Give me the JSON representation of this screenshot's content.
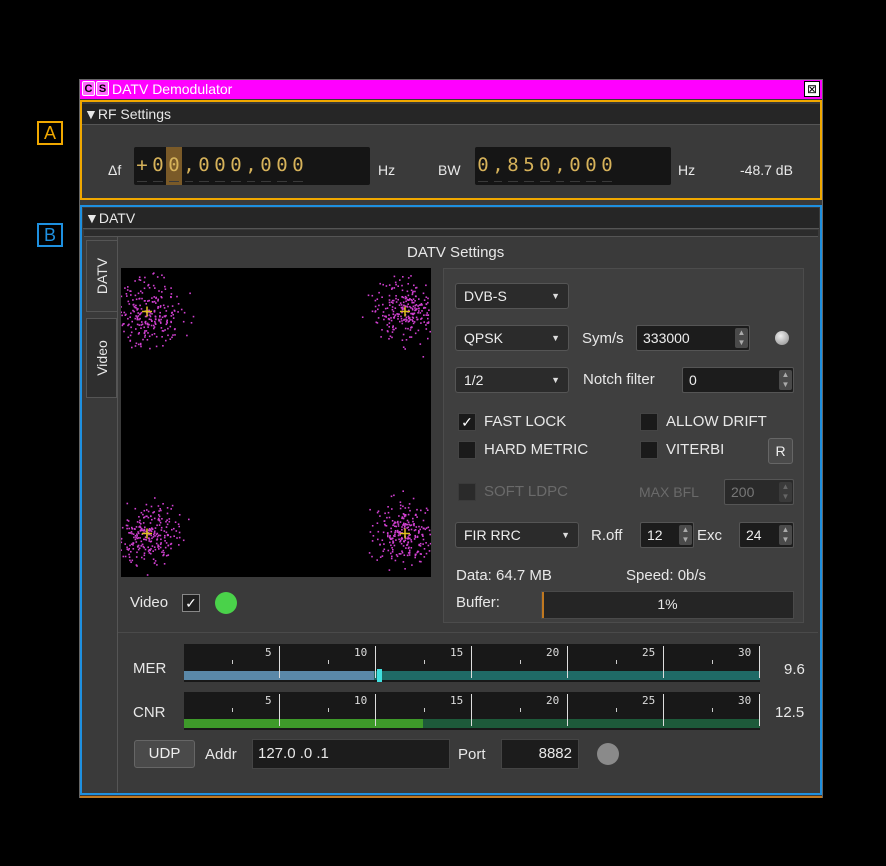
{
  "window": {
    "title": "DATV Demodulator",
    "btn_c": "C",
    "btn_s": "S",
    "close": "⊠"
  },
  "annotations": {
    "a": "A",
    "b": "B"
  },
  "rf_settings": {
    "header": "RF Settings",
    "df_label": "Δf",
    "df_digits": [
      "+",
      "0",
      "0",
      ",",
      "0",
      "0",
      "0",
      ",",
      "0",
      "0",
      "0"
    ],
    "df_unit": "Hz",
    "bw_label": "BW",
    "bw_digits": [
      "0",
      ",",
      "8",
      "5",
      "0",
      ",",
      "0",
      "0",
      "0"
    ],
    "bw_unit": "Hz",
    "level": "-48.7 dB"
  },
  "datv": {
    "header": "DATV",
    "tabs": [
      "DATV",
      "Video"
    ],
    "settings_title": "DATV Settings",
    "standard": "DVB-S",
    "modulation": "QPSK",
    "symrate_label": "Sym/s",
    "symrate": "333000",
    "fec": "1/2",
    "notch_label": "Notch filter",
    "notch": "0",
    "fast_lock": {
      "label": "FAST LOCK",
      "checked": true
    },
    "allow_drift": {
      "label": "ALLOW DRIFT",
      "checked": false
    },
    "hard_metric": {
      "label": "HARD METRIC",
      "checked": false
    },
    "viterbi": {
      "label": "VITERBI",
      "checked": false
    },
    "r_button": "R",
    "soft_ldpc": {
      "label": "SOFT LDPC",
      "checked": false
    },
    "max_bfl_label": "MAX BFL",
    "max_bfl": "200",
    "filter": "FIR RRC",
    "roff_label": "R.off",
    "roff": "12",
    "exc_label": "Exc",
    "exc": "24",
    "data_label": "Data: 64.7 MB",
    "speed_label": "Speed: 0b/s",
    "buffer_label": "Buffer:",
    "buffer_value": "1%",
    "buffer_fraction": 0.01,
    "video_label": "Video",
    "video_checked": true,
    "video_led_color": "#4ad24a",
    "constellation_points": [
      [
        -0.5,
        0.5
      ],
      [
        0.5,
        0.5
      ],
      [
        -0.5,
        -0.5
      ],
      [
        0.5,
        -0.5
      ]
    ],
    "constellation_color": "#d040d0",
    "marker_color": "#e0c020"
  },
  "meters": {
    "scale": [
      "5",
      "10",
      "15",
      "20",
      "25",
      "30"
    ],
    "mer": {
      "label": "MER",
      "value": "9.6",
      "bar_fraction": 0.33,
      "mark_fraction": 0.335,
      "bar_color": "#5a88a8",
      "track_color": "#1f6a66"
    },
    "cnr": {
      "label": "CNR",
      "value": "12.5",
      "bar_fraction": 0.415,
      "track_color": "#1d5a3a",
      "bar_color": "#3e9a2a"
    }
  },
  "udp": {
    "button": "UDP",
    "addr_label": "Addr",
    "addr": "127.0 .0 .1",
    "port_label": "Port",
    "port": "8882",
    "led_color": "#8a8a8a"
  }
}
